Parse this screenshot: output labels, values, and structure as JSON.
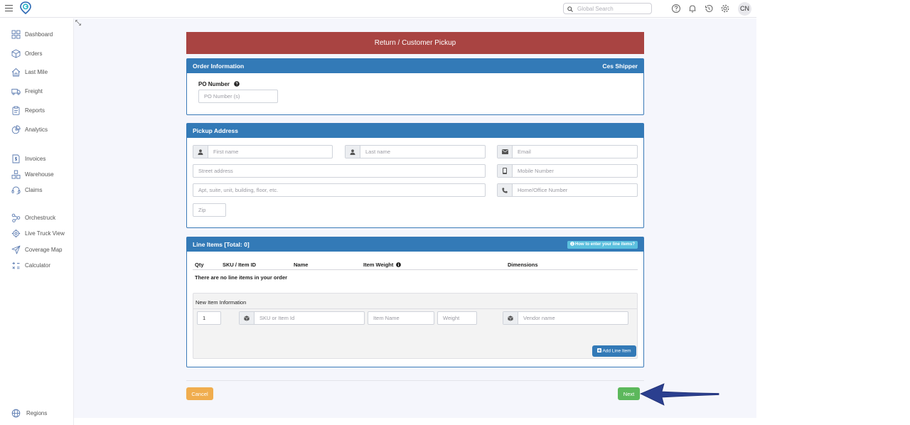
{
  "topbar": {
    "search_placeholder": "Global Search",
    "avatar_initials": "CN",
    "icons": [
      "help-icon",
      "bell-icon",
      "history-icon",
      "gear-icon"
    ]
  },
  "sidebar": {
    "items": [
      {
        "label": "Dashboard",
        "icon": "grid-icon"
      },
      {
        "label": "Orders",
        "icon": "box-icon"
      },
      {
        "label": "Last Mile",
        "icon": "house-icon"
      },
      {
        "label": "Freight",
        "icon": "truck-icon"
      },
      {
        "label": "Reports",
        "icon": "clipboard-icon"
      },
      {
        "label": "Analytics",
        "icon": "pie-icon"
      },
      {
        "label": "Invoices",
        "icon": "invoice-icon"
      },
      {
        "label": "Warehouse",
        "icon": "warehouse-icon"
      },
      {
        "label": "Claims",
        "icon": "headset-icon"
      },
      {
        "label": "Orchestruck",
        "icon": "nodes-icon"
      },
      {
        "label": "Live Truck View",
        "icon": "target-icon"
      },
      {
        "label": "Coverage Map",
        "icon": "send-icon"
      },
      {
        "label": "Calculator",
        "icon": "calculator-icon"
      }
    ],
    "footer_label": "Regions"
  },
  "banner": {
    "title": "Return / Customer Pickup"
  },
  "order_info": {
    "title": "Order Information",
    "shipper": "Ces Shipper",
    "po_label": "PO Number",
    "po_placeholder": "PO Number (s)"
  },
  "pickup": {
    "title": "Pickup Address",
    "first_name_placeholder": "First name",
    "last_name_placeholder": "Last name",
    "email_placeholder": "Email",
    "street_placeholder": "Street address",
    "mobile_placeholder": "Mobile Number",
    "apt_placeholder": "Apt, suite, unit, building, floor, etc.",
    "home_placeholder": "Home/Office Number",
    "zip_placeholder": "Zip"
  },
  "line_items": {
    "title": "Line Items [Total: 0]",
    "help_label": "How to enter your line items?",
    "columns": [
      "Qty",
      "SKU / Item ID",
      "Name",
      "Item Weight",
      "Dimensions"
    ],
    "empty_text": "There are no line items in your order",
    "new_item_title": "New Item Information",
    "qty_value": "1",
    "sku_placeholder": "SKU or Item Id",
    "name_placeholder": "Item Name",
    "weight_placeholder": "Weight",
    "vendor_placeholder": "Vendor name",
    "add_label": "Add Line Item"
  },
  "footer": {
    "cancel_label": "Cancel",
    "next_label": "Next"
  },
  "colors": {
    "banner": "#a94442",
    "panel_header": "#337ab7",
    "cancel": "#f0ad4e",
    "next": "#5cb85c",
    "arrow": "#2b3f8f"
  }
}
